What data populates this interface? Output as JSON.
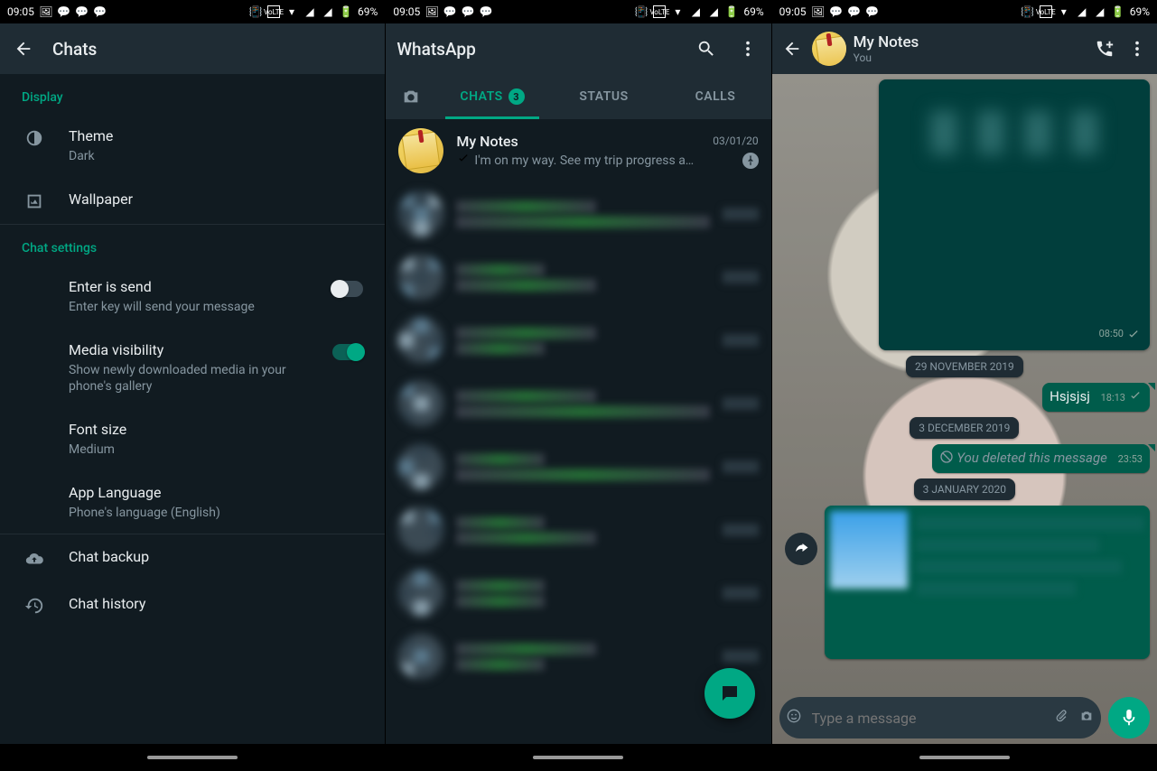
{
  "status": {
    "time": "09:05",
    "battery": "69%"
  },
  "settings": {
    "title": "Chats",
    "display_hdr": "Display",
    "theme": {
      "title": "Theme",
      "value": "Dark"
    },
    "wallpaper": {
      "title": "Wallpaper"
    },
    "chat_hdr": "Chat settings",
    "enter_send": {
      "title": "Enter is send",
      "sub": "Enter key will send your message",
      "on": false
    },
    "media_vis": {
      "title": "Media visibility",
      "sub": "Show newly downloaded media in your phone's gallery",
      "on": true
    },
    "font_size": {
      "title": "Font size",
      "value": "Medium"
    },
    "app_lang": {
      "title": "App Language",
      "value": "Phone's language (English)"
    },
    "backup": {
      "title": "Chat backup"
    },
    "history": {
      "title": "Chat history"
    }
  },
  "chats": {
    "title": "WhatsApp",
    "tabs": {
      "chats": "CHATS",
      "status": "STATUS",
      "calls": "CALLS",
      "badge": "3"
    },
    "mynotes": {
      "name": "My Notes",
      "time": "03/01/20",
      "preview": "I'm on my way. See my trip progress a…"
    }
  },
  "convo": {
    "title": "My Notes",
    "subtitle": "You",
    "card_time": "08:50",
    "dates": [
      "29 NOVEMBER 2019",
      "3 DECEMBER 2019",
      "3 JANUARY 2020"
    ],
    "msg1": {
      "text": "Hsjsjsj",
      "time": "18:13"
    },
    "deleted": {
      "text": "You deleted this message",
      "time": "23:53"
    },
    "input_placeholder": "Type a message"
  }
}
